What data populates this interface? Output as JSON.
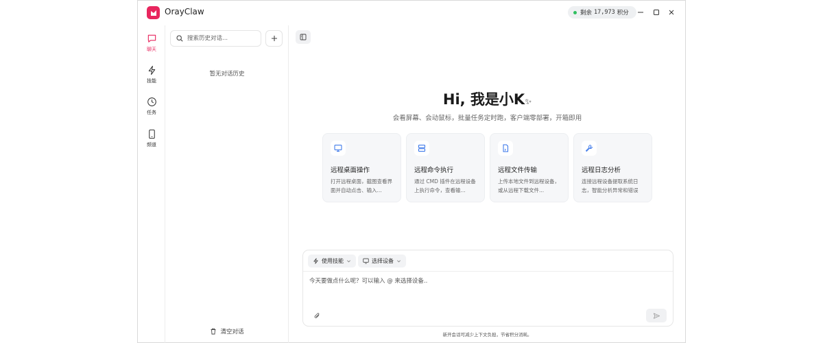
{
  "app": {
    "title": "OrayClaw"
  },
  "credits": {
    "prefix": "剩余",
    "amount": "17,973",
    "unit": "积分",
    "status_color": "#2fbf5f"
  },
  "theme": {
    "accent": "#e8265e"
  },
  "rail": {
    "items": [
      {
        "label": "聊天",
        "icon": "chat-icon",
        "active": true
      },
      {
        "label": "技能",
        "icon": "lightning-icon",
        "active": false
      },
      {
        "label": "任务",
        "icon": "clock-icon",
        "active": false
      },
      {
        "label": "频道",
        "icon": "phone-icon",
        "active": false
      }
    ]
  },
  "history": {
    "search_placeholder": "搜索历史对话...",
    "empty_text": "暂无对话历史",
    "clear_label": "清空对话"
  },
  "hero": {
    "title": "Hi, 我是小K",
    "subtitle": "会看屏幕、会动鼠标，批量任务定时跑，客户端零部署，开箱即用"
  },
  "cards": [
    {
      "title": "远程桌面操作",
      "desc": "打开远程桌面，截图查看界面并自动点击、输入...",
      "icon": "monitor-icon"
    },
    {
      "title": "远程命令执行",
      "desc": "通过 CMD 插件在远程设备上执行命令，查看输...",
      "icon": "server-icon"
    },
    {
      "title": "远程文件传输",
      "desc": "上传本地文件到远程设备，或从远程下载文件...",
      "icon": "file-icon"
    },
    {
      "title": "远程日志分析",
      "desc": "连接远程设备提取系统日志，智能分析异常和错误",
      "icon": "wrench-icon"
    }
  ],
  "composer": {
    "skills_chip": "使用技能",
    "device_chip": "选择设备",
    "placeholder": "今天要做点什么呢？可以输入 @ 来选择设备..",
    "note": "新开会话可减少上下文负担，节省积分消耗。"
  }
}
